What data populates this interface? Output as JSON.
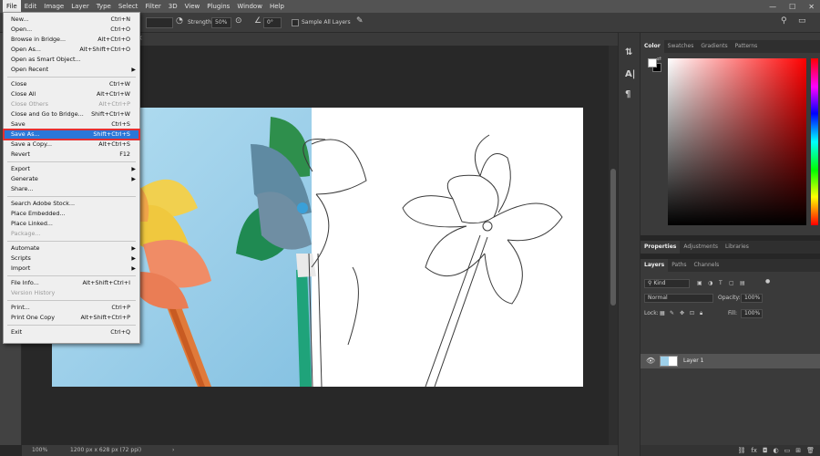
{
  "menubar": {
    "items": [
      "File",
      "Edit",
      "Image",
      "Layer",
      "Type",
      "Select",
      "Filter",
      "3D",
      "View",
      "Plugins",
      "Window",
      "Help"
    ],
    "active": "File",
    "window_controls": [
      "minimize-icon",
      "maximize-icon",
      "close-icon"
    ]
  },
  "options": {
    "strength_label": "Strength:",
    "strength_value": "50%",
    "angle_value": "0°",
    "sample_all_layers": "Sample All Layers"
  },
  "file_menu": {
    "items": [
      {
        "label": "New...",
        "shortcut": "Ctrl+N"
      },
      {
        "label": "Open...",
        "shortcut": "Ctrl+O"
      },
      {
        "label": "Browse in Bridge...",
        "shortcut": "Alt+Ctrl+O"
      },
      {
        "label": "Open As...",
        "shortcut": "Alt+Shift+Ctrl+O"
      },
      {
        "label": "Open as Smart Object..."
      },
      {
        "label": "Open Recent",
        "submenu": true
      },
      {
        "label": "Close",
        "shortcut": "Ctrl+W"
      },
      {
        "label": "Close All",
        "shortcut": "Alt+Ctrl+W"
      },
      {
        "label": "Close Others",
        "shortcut": "Alt+Ctrl+P",
        "disabled": true
      },
      {
        "label": "Close and Go to Bridge...",
        "shortcut": "Shift+Ctrl+W"
      },
      {
        "label": "Save",
        "shortcut": "Ctrl+S"
      },
      {
        "label": "Save As...",
        "shortcut": "Shift+Ctrl+S",
        "highlighted": true
      },
      {
        "label": "Save a Copy...",
        "shortcut": "Alt+Ctrl+S"
      },
      {
        "label": "Revert",
        "shortcut": "F12"
      },
      {
        "label": "Export",
        "submenu": true
      },
      {
        "label": "Generate",
        "submenu": true
      },
      {
        "label": "Share..."
      },
      {
        "label": "Search Adobe Stock..."
      },
      {
        "label": "Place Embedded..."
      },
      {
        "label": "Place Linked..."
      },
      {
        "label": "Package...",
        "disabled": true
      },
      {
        "label": "Automate",
        "submenu": true
      },
      {
        "label": "Scripts",
        "submenu": true
      },
      {
        "label": "Import",
        "submenu": true
      },
      {
        "label": "File Info...",
        "shortcut": "Alt+Shift+Ctrl+I"
      },
      {
        "label": "Version History",
        "disabled": true
      },
      {
        "label": "Print...",
        "shortcut": "Ctrl+P"
      },
      {
        "label": "Print One Copy",
        "shortcut": "Alt+Shift+Ctrl+P"
      },
      {
        "label": "Exit",
        "shortcut": "Ctrl+Q"
      }
    ]
  },
  "color_panel": {
    "tabs": [
      "Color",
      "Swatches",
      "Gradients",
      "Patterns"
    ],
    "active": "Color",
    "foreground": "#ffffff",
    "background": "#000000",
    "hue_color": "#ff0000"
  },
  "properties_tabs": [
    "Properties",
    "Adjustments",
    "Libraries"
  ],
  "layers_panel": {
    "tabs": [
      "Layers",
      "Paths",
      "Channels"
    ],
    "active": "Layers",
    "filter_kind": "Kind",
    "blend_mode": "Normal",
    "opacity_label": "Opacity:",
    "opacity_value": "100%",
    "lock_label": "Lock:",
    "fill_label": "Fill:",
    "fill_value": "100%",
    "layer_name": "Layer 1"
  },
  "status": {
    "zoom": "100%",
    "doc_info": "1200 px x 628 px (72 ppi)"
  },
  "colors": {
    "accent": "#2a77d8",
    "highlight_border": "#e43032",
    "panel_bg": "#3a3a3a",
    "canvas_bg": "#282828"
  }
}
